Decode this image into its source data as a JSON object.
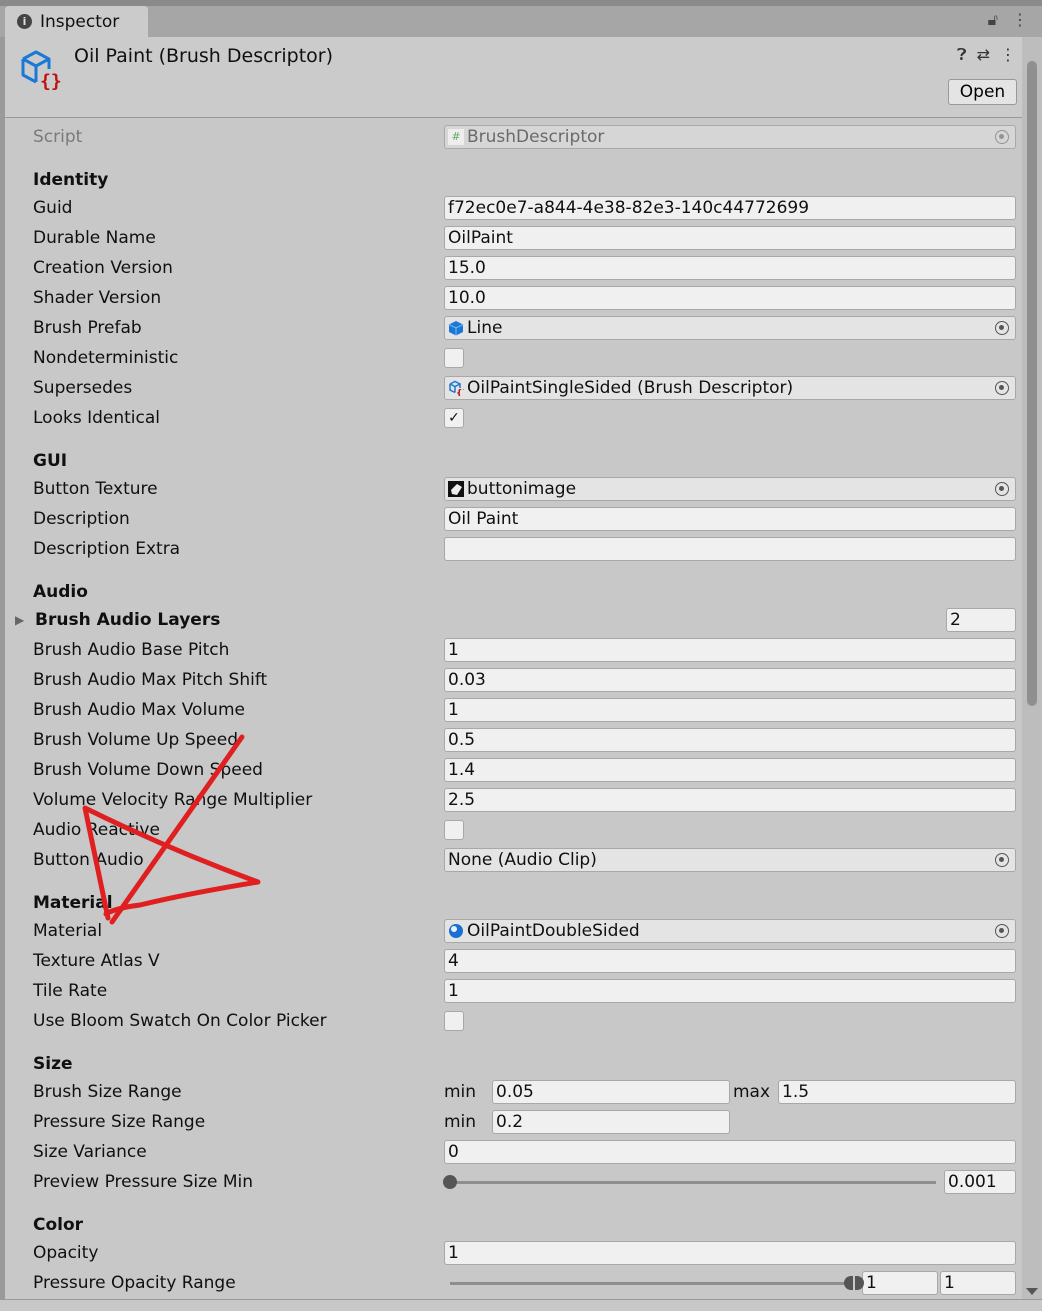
{
  "tab": {
    "label": "Inspector",
    "icon": "info-icon"
  },
  "header": {
    "title": "Oil Paint (Brush Descriptor)",
    "open_label": "Open",
    "icon": "scriptable-object-icon"
  },
  "script_row": {
    "label": "Script",
    "value": "BrushDescriptor"
  },
  "sections": [
    {
      "title": "Identity",
      "rows": [
        {
          "label": "Guid",
          "type": "text",
          "value": "f72ec0e7-a844-4e38-82e3-140c44772699"
        },
        {
          "label": "Durable Name",
          "type": "text",
          "value": "OilPaint"
        },
        {
          "label": "Creation Version",
          "type": "text",
          "value": "15.0"
        },
        {
          "label": "Shader Version",
          "type": "text",
          "value": "10.0"
        },
        {
          "label": "Brush Prefab",
          "type": "object",
          "value": "Line",
          "icon": "prefab-cube-icon"
        },
        {
          "label": "Nondeterministic",
          "type": "checkbox",
          "checked": false
        },
        {
          "label": "Supersedes",
          "type": "object",
          "value": "OilPaintSingleSided (Brush Descriptor)",
          "icon": "scriptable-object-icon"
        },
        {
          "label": "Looks Identical",
          "type": "checkbox",
          "checked": true
        }
      ]
    },
    {
      "title": "GUI",
      "rows": [
        {
          "label": "Button Texture",
          "type": "object",
          "value": "buttonimage",
          "icon": "texture-icon"
        },
        {
          "label": "Description",
          "type": "text",
          "value": "Oil Paint"
        },
        {
          "label": "Description Extra",
          "type": "text",
          "value": ""
        }
      ]
    },
    {
      "title": "Audio",
      "rows": [
        {
          "label": "Brush Audio Layers",
          "type": "foldout",
          "value": "2"
        },
        {
          "label": "Brush Audio Base Pitch",
          "type": "text",
          "value": "1"
        },
        {
          "label": "Brush Audio Max Pitch Shift",
          "type": "text",
          "value": "0.03"
        },
        {
          "label": "Brush Audio Max Volume",
          "type": "text",
          "value": "1"
        },
        {
          "label": "Brush Volume Up Speed",
          "type": "text",
          "value": "0.5"
        },
        {
          "label": "Brush Volume Down Speed",
          "type": "text",
          "value": "1.4"
        },
        {
          "label": "Volume Velocity Range Multiplier",
          "type": "text",
          "value": "2.5"
        },
        {
          "label": "Audio Reactive",
          "type": "checkbox",
          "checked": false
        },
        {
          "label": "Button Audio",
          "type": "object",
          "value": "None (Audio Clip)",
          "icon": ""
        }
      ]
    },
    {
      "title": "Material",
      "rows": [
        {
          "label": "Material",
          "type": "object",
          "value": "OilPaintDoubleSided",
          "icon": "material-sphere-icon"
        },
        {
          "label": "Texture Atlas V",
          "type": "text",
          "value": "4"
        },
        {
          "label": "Tile Rate",
          "type": "text",
          "value": "1"
        },
        {
          "label": "Use Bloom Swatch On Color Picker",
          "type": "checkbox",
          "checked": false
        }
      ]
    },
    {
      "title": "Size",
      "rows": [
        {
          "label": "Brush Size Range",
          "type": "minmax",
          "min_label": "min",
          "min": "0.05",
          "max_label": "max",
          "max": "1.5"
        },
        {
          "label": "Pressure Size Range",
          "type": "min",
          "min_label": "min",
          "min": "0.2"
        },
        {
          "label": "Size Variance",
          "type": "text",
          "value": "0"
        },
        {
          "label": "Preview Pressure Size Min",
          "type": "slider",
          "value": "0.001",
          "fraction": 0.001
        }
      ]
    },
    {
      "title": "Color",
      "rows": [
        {
          "label": "Opacity",
          "type": "text",
          "value": "1"
        },
        {
          "label": "Pressure Opacity Range",
          "type": "range",
          "min": "1",
          "max": "1",
          "fraction_min": 1,
          "fraction_max": 1
        }
      ]
    }
  ],
  "annotation": {
    "color": "#e02020",
    "description_visible": false
  }
}
